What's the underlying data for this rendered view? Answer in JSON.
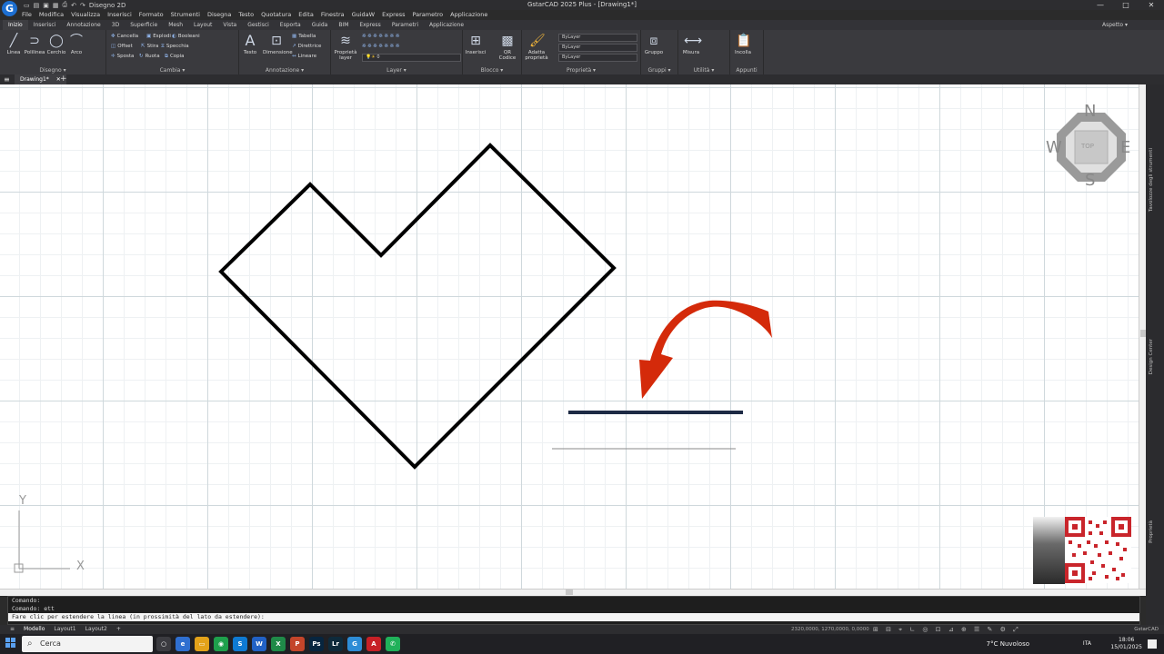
{
  "window": {
    "title": "GstarCAD 2025 Plus - [Drawing1*]",
    "workspace_dropdown": "Disegno 2D",
    "app_logo": "G",
    "controls": [
      "—",
      "□",
      "✕"
    ]
  },
  "menubar": [
    "File",
    "Modifica",
    "Visualizza",
    "Inserisci",
    "Formato",
    "Strumenti",
    "Disegna",
    "Testo",
    "Quotatura",
    "Edita",
    "Finestra",
    "GuidaW",
    "Express",
    "Parametro",
    "Applicazione"
  ],
  "ribbon_tabs": {
    "items": [
      "Inizio",
      "Inserisci",
      "Annotazione",
      "3D",
      "Superficie",
      "Mesh",
      "Layout",
      "Vista",
      "Gestisci",
      "Esporta",
      "Guida",
      "BIM",
      "Express",
      "Parametri",
      "Applicazione"
    ],
    "active": "Inizio",
    "right_label": "Aspetto ▾"
  },
  "ribbon": {
    "disegno": {
      "title": "Disegno ▾",
      "tools": [
        "Linea",
        "Polilinea",
        "Cerchio",
        "Arco"
      ]
    },
    "cambia": {
      "title": "Cambia ▾",
      "tools": [
        "Cancella",
        "Esplodi",
        "Booleani",
        "Offset",
        "Stira",
        "Specchia",
        "Sposta",
        "Ruota",
        "Copia"
      ]
    },
    "annotazione": {
      "title": "Annotazione ▾",
      "tools": [
        "Testo",
        "Dimensione",
        "Tabella",
        "Direttrice",
        "Linearе"
      ]
    },
    "layer": {
      "title": "Layer ▾",
      "tools": [
        "Proprietà layer"
      ],
      "current_layer": "0"
    },
    "blocco": {
      "title": "Blocco ▾",
      "tools": [
        "Inserisci",
        "QR Codice"
      ]
    },
    "proprieta": {
      "title": "Proprietà ▾",
      "tools": [
        "Adatta proprietà"
      ],
      "combos": [
        "ByLayer",
        "ByLayer",
        "ByLayer"
      ]
    },
    "gruppi": {
      "title": "Gruppi ▾",
      "tools": [
        "Gruppo"
      ]
    },
    "utilita": {
      "title": "Utilità ▾",
      "tools": [
        "Misura"
      ]
    },
    "appunti": {
      "title": "Appunti",
      "tools": [
        "Incolla"
      ]
    }
  },
  "document_tab": {
    "label": "Drawing1*",
    "close": "✕",
    "new": "+"
  },
  "viewcube": {
    "n": "N",
    "s": "S",
    "e": "E",
    "w": "W",
    "face": "TOP"
  },
  "ucs": {
    "x": "X",
    "y": "Y"
  },
  "side_palettes": [
    "Tavolozze degli strumenti",
    "Design Center",
    "Proprietà"
  ],
  "command_line": {
    "history": [
      "Comando:",
      "Comando: ett"
    ],
    "prompt": "Fare clic per estendere la linea (in prossimità del lato da estendere):"
  },
  "status": {
    "layout_tabs": [
      "Modello",
      "Layout1",
      "Layout2"
    ],
    "active_tab": "Modello",
    "coords": "2320,0000, 1270,0000, 0,0000",
    "brand": "GstarCAD"
  },
  "taskbar": {
    "search_placeholder": "Cerca",
    "weather": "7°C  Nuvoloso",
    "lang": "ITA",
    "time": "18:06",
    "date": "15/01/2025"
  },
  "colors": {
    "accent": "#1d6fd1",
    "arrow": "#d42a0a",
    "target_line": "#1d2a44",
    "shape_stroke": "#000000"
  }
}
